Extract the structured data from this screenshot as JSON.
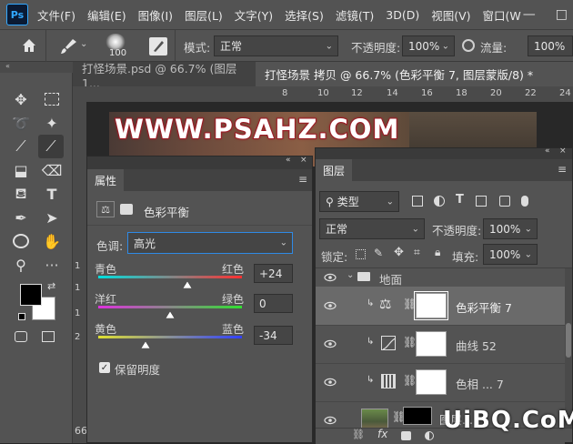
{
  "app": {
    "logo": "Ps"
  },
  "menu": [
    "文件(F)",
    "编辑(E)",
    "图像(I)",
    "图层(L)",
    "文字(Y)",
    "选择(S)",
    "滤镜(T)",
    "3D(D)",
    "视图(V)",
    "窗口(W"
  ],
  "window_controls": {
    "minimize": "—",
    "maximize": "□"
  },
  "options": {
    "brush_size": "100",
    "mode_label": "模式:",
    "mode_value": "正常",
    "opacity_label": "不透明度:",
    "opacity_value": "100%",
    "flow_label": "流量:",
    "flow_value": "100%"
  },
  "tabs": [
    {
      "label": "打怪场景.psd @ 66.7% (图层 1...",
      "active": false
    },
    {
      "label": "打怪场景 拷贝 @ 66.7% (色彩平衡 7, 图层蒙版/8) *",
      "active": true
    }
  ],
  "ruler": [
    "8",
    "10",
    "12",
    "14",
    "16",
    "18",
    "20",
    "22",
    "24"
  ],
  "canvas": {
    "watermark": "WWW.PSAHZ.COM",
    "zoom": "66"
  },
  "properties": {
    "title": "属性",
    "adjustment_name": "色彩平衡",
    "tone_label": "色调:",
    "tone_value": "高光",
    "sliders": [
      {
        "left": "青色",
        "right": "红色",
        "value": "+24",
        "fraction": 0.62
      },
      {
        "left": "洋红",
        "right": "绿色",
        "value": "0",
        "fraction": 0.5
      },
      {
        "left": "黄色",
        "right": "蓝色",
        "value": "-34",
        "fraction": 0.33
      }
    ],
    "preserve_label": "保留明度",
    "preserve_checked": true,
    "ruler_numbers": [
      "1",
      "1",
      "1",
      "2"
    ]
  },
  "layers": {
    "title": "图层",
    "filter_label": "类型",
    "blend_mode": "正常",
    "opacity_label": "不透明度:",
    "opacity_value": "100%",
    "lock_label": "锁定:",
    "fill_label": "填充:",
    "fill_value": "100%",
    "group_name": "地面",
    "items": [
      {
        "name": "色彩平衡 7",
        "selected": true
      },
      {
        "name": "曲线 52",
        "selected": false
      },
      {
        "name": "色相 ... 7",
        "selected": false
      },
      {
        "name": "图层...",
        "selected": false
      }
    ]
  },
  "site_watermark": "UiBQ.CoM"
}
